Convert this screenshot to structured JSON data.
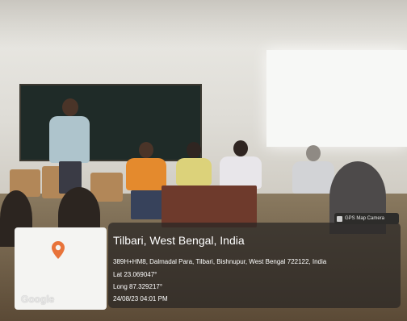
{
  "overlay": {
    "badge_label": "GPS Map Camera",
    "place": "Tilbari, West Bengal, India",
    "address": "389H+HM8, Dalmadal Para, Tilbari, Bishnupur, West Bengal 722122, India",
    "lat": "Lat 23.069047°",
    "long": "Long 87.329217°",
    "datetime": "24/08/23 04:01 PM"
  },
  "map": {
    "logo": "Google",
    "pin_icon": "map-pin-icon",
    "pin_color": "#e8733a"
  },
  "colors": {
    "overlay_bg": "#282624",
    "text": "#ffffff"
  }
}
